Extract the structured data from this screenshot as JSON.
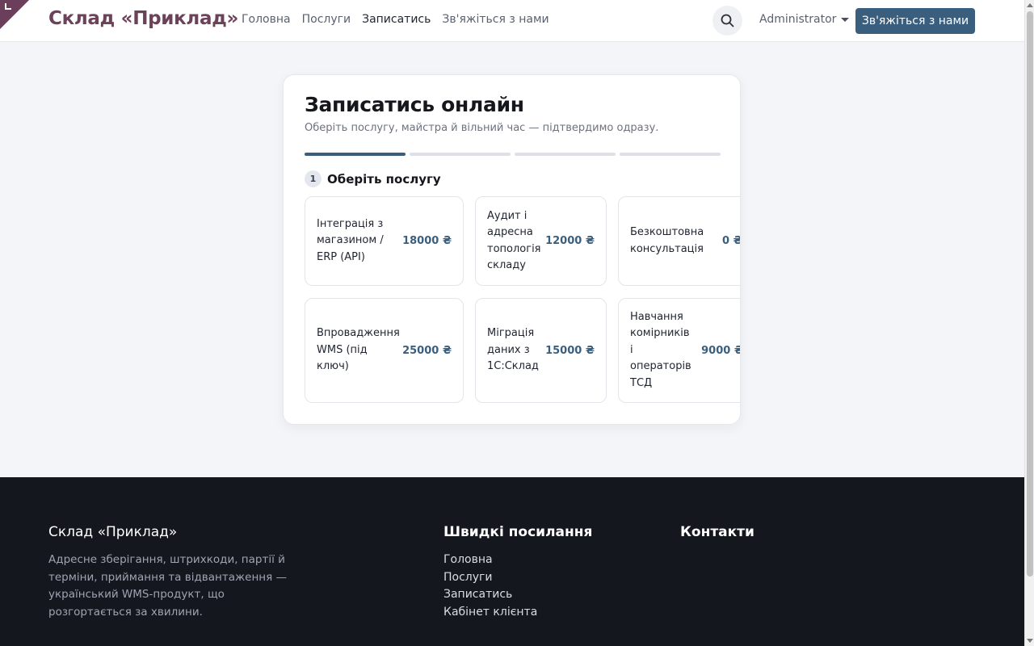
{
  "header": {
    "brand": "Склад «Приклад»",
    "nav": [
      "Головна",
      "Послуги",
      "Записатись",
      "Зв'яжіться з нами"
    ],
    "active_nav": "Записатись",
    "user": "Administrator",
    "cta": "Зв'яжіться з нами",
    "icons": {
      "search": "search-icon",
      "caret": "chevron-down-icon"
    }
  },
  "booking": {
    "title": "Записатись онлайн",
    "subtitle": "Оберіть послугу, майстра й вільний час — підтвердимо одразу.",
    "progress": {
      "total_steps": 4,
      "current_step": 1
    },
    "step": {
      "number": "1",
      "title": "Оберіть послугу"
    },
    "services": [
      {
        "name": "Інтеграція з магазином / ERP (API)",
        "price": "18000 ₴"
      },
      {
        "name": "Аудит і адресна топологія складу",
        "price": "12000 ₴"
      },
      {
        "name": "Безкоштовна консультація",
        "price": "0 ₴"
      },
      {
        "name": "Впровадження WMS (під ключ)",
        "price": "25000 ₴"
      },
      {
        "name": "Міграція даних з 1С:Склад",
        "price": "15000 ₴"
      },
      {
        "name": "Навчання комірників і операторів ТСД",
        "price": "9000 ₴"
      }
    ]
  },
  "footer": {
    "brand": "Склад «Приклад»",
    "description": "Адресне зберігання, штрихкоди, партії й терміни, приймання та відвантаження — український WMS-продукт, що розгортається за хвилини.",
    "quick_links_title": "Швидкі посилання",
    "quick_links": [
      "Головна",
      "Послуги",
      "Записатись",
      "Кабінет клієнта"
    ],
    "contacts_title": "Контакти"
  },
  "colors": {
    "accent": "#3a5f7e",
    "brand": "#6b4259",
    "footer_bg": "#15171e"
  }
}
